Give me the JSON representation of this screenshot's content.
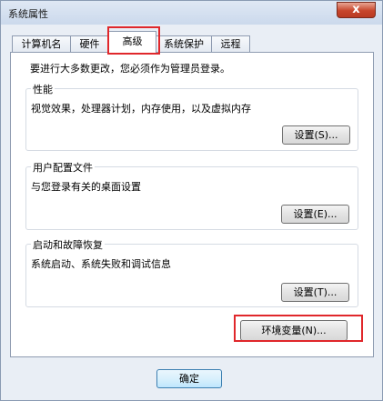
{
  "window": {
    "title": "系统属性",
    "close_symbol": "x"
  },
  "tabs": [
    {
      "label": "计算机名"
    },
    {
      "label": "硬件"
    },
    {
      "label": "高级"
    },
    {
      "label": "系统保护"
    },
    {
      "label": "远程"
    }
  ],
  "advanced": {
    "admin_notice": "要进行大多数更改，您必须作为管理员登录。",
    "performance": {
      "title": "性能",
      "description": "视觉效果，处理器计划，内存使用，以及虚拟内存",
      "button": "设置(S)..."
    },
    "user_profiles": {
      "title": "用户配置文件",
      "description": "与您登录有关的桌面设置",
      "button": "设置(E)..."
    },
    "startup_recovery": {
      "title": "启动和故障恢复",
      "description": "系统启动、系统失败和调试信息",
      "button": "设置(T)..."
    },
    "env_button": "环境变量(N)..."
  },
  "footer": {
    "ok_button": "确定"
  },
  "colors": {
    "highlight": "#e0272b",
    "window_bg": "#e9eef5",
    "close_button": "#c7452b"
  }
}
